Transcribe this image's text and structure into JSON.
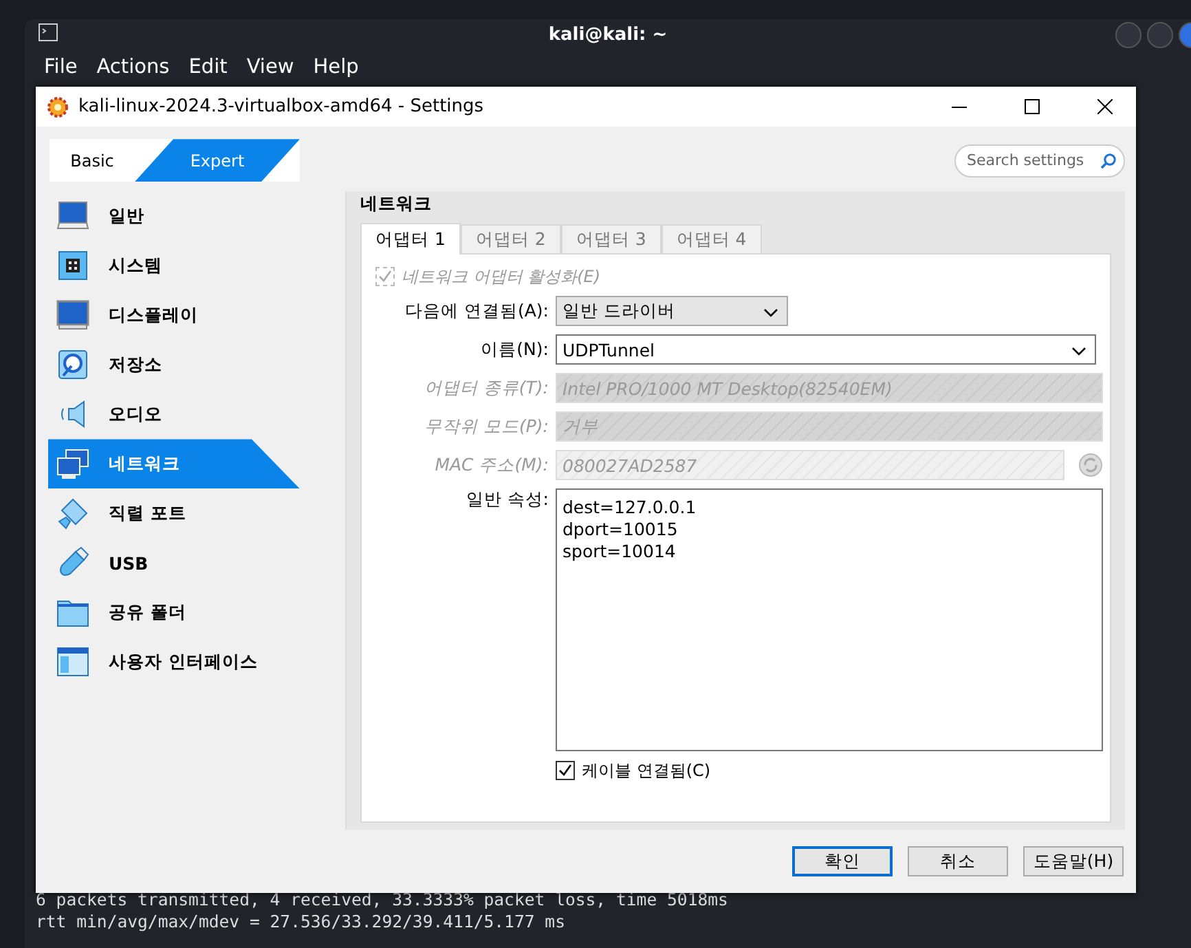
{
  "terminal": {
    "title": "kali@kali: ~",
    "menu": [
      "File",
      "Actions",
      "Edit",
      "View",
      "Help"
    ],
    "output_lines": [
      "6 packets transmitted, 4 received, 33.3333% packet loss, time 5018ms",
      "rtt min/avg/max/mdev = 27.536/33.292/39.411/5.177 ms"
    ]
  },
  "dialog": {
    "title": "kali-linux-2024.3-virtualbox-amd64 - Settings",
    "mode_tabs": [
      {
        "label": "Basic",
        "selected": false
      },
      {
        "label": "Expert",
        "selected": true
      }
    ],
    "search": {
      "placeholder": "Search settings"
    },
    "sidebar": {
      "items": [
        {
          "label": "일반",
          "selected": false
        },
        {
          "label": "시스템",
          "selected": false
        },
        {
          "label": "디스플레이",
          "selected": false
        },
        {
          "label": "저장소",
          "selected": false
        },
        {
          "label": "오디오",
          "selected": false
        },
        {
          "label": "네트워크",
          "selected": true
        },
        {
          "label": "직렬 포트",
          "selected": false
        },
        {
          "label": "USB",
          "selected": false
        },
        {
          "label": "공유 폴더",
          "selected": false
        },
        {
          "label": "사용자 인터페이스",
          "selected": false
        }
      ]
    },
    "section_title": "네트워크",
    "adapter_tabs": [
      {
        "label": "어댑터 1",
        "selected": true
      },
      {
        "label": "어댑터 2",
        "selected": false
      },
      {
        "label": "어댑터 3",
        "selected": false
      },
      {
        "label": "어댑터 4",
        "selected": false
      }
    ],
    "enable_adapter": {
      "label": "네트워크 어댑터 활성화(E)",
      "checked": true,
      "disabled": true
    },
    "fields": [
      {
        "kind": "combo",
        "label": "다음에 연결됨(A):",
        "value": "일반 드라이버",
        "disabled": false
      },
      {
        "kind": "editable-combo",
        "label": "이름(N):",
        "value": "UDPTunnel",
        "disabled": false
      },
      {
        "kind": "combo",
        "label": "어댑터 종류(T):",
        "value": "Intel PRO/1000 MT Desktop(82540EM)",
        "disabled": true
      },
      {
        "kind": "combo",
        "label": "무작위 모드(P):",
        "value": "거부",
        "disabled": true
      },
      {
        "kind": "text",
        "label": "MAC 주소(M):",
        "value": "080027AD2587",
        "disabled": true
      }
    ],
    "properties": {
      "label": "일반 속성:",
      "lines": [
        "dest=127.0.0.1",
        "dport=10015",
        "sport=10014"
      ]
    },
    "cable_connected": {
      "label": "케이블 연결됨(C)",
      "checked": true
    },
    "buttons": [
      {
        "label": "확인",
        "default": true
      },
      {
        "label": "취소",
        "default": false
      },
      {
        "label": "도움말(H)",
        "default": false
      }
    ]
  }
}
